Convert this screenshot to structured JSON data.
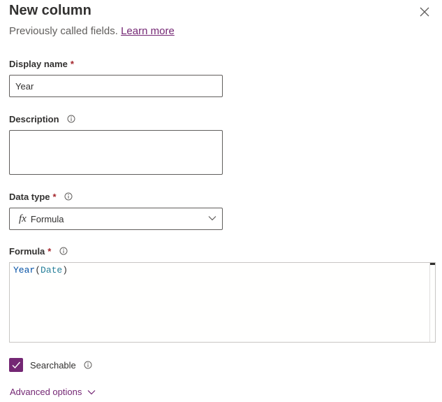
{
  "panel": {
    "title": "New column",
    "subtitle": "Previously called fields.",
    "learn_more": "Learn more"
  },
  "fields": {
    "display_name": {
      "label": "Display name",
      "required_mark": "*",
      "value": "Year"
    },
    "description": {
      "label": "Description",
      "value": ""
    },
    "data_type": {
      "label": "Data type",
      "required_mark": "*",
      "icon_text": "fx",
      "value": "Formula"
    },
    "formula": {
      "label": "Formula",
      "required_mark": "*",
      "fn": "Year",
      "open": "(",
      "arg": "Date",
      "close": ")"
    }
  },
  "searchable": {
    "label": "Searchable",
    "checked": true
  },
  "advanced": {
    "label": "Advanced options"
  },
  "colors": {
    "accent": "#742774",
    "required": "#a4262c",
    "border": "#605e5c",
    "code": "#0451a5",
    "code_arg": "#267f99"
  },
  "icons": [
    "close-icon",
    "info-icon",
    "chevron-down-icon",
    "check-icon"
  ]
}
